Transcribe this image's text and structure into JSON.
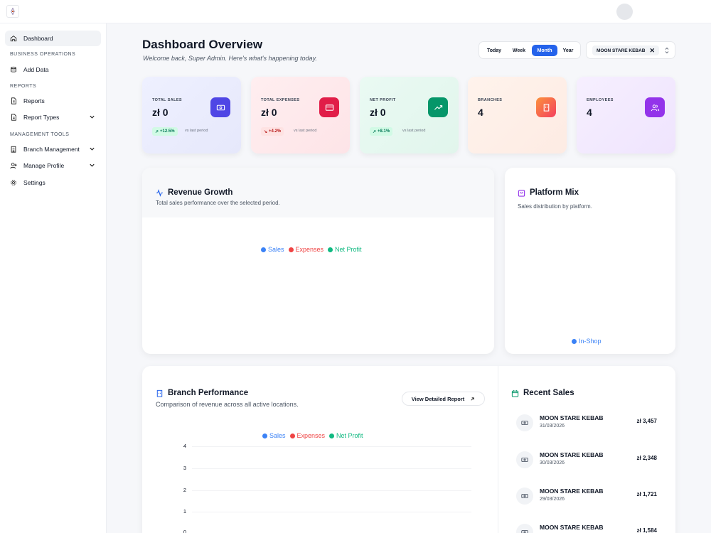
{
  "sidebar": {
    "dashboard": "Dashboard",
    "section_business": "BUSINESS OPERATIONS",
    "add_data": "Add Data",
    "section_reports": "REPORTS",
    "reports": "Reports",
    "report_types": "Report Types",
    "section_management": "MANAGEMENT TOOLS",
    "branch_management": "Branch Management",
    "manage_profile": "Manage Profile",
    "settings": "Settings"
  },
  "header": {
    "title": "Dashboard Overview",
    "subtitle": "Welcome back, Super Admin. Here's what's happening today."
  },
  "period": {
    "options": [
      "Today",
      "Week",
      "Month",
      "Year"
    ],
    "selected": "Month"
  },
  "branch_filter": {
    "value": "MOON STARE KEBAB",
    "clear": "✕"
  },
  "stats": [
    {
      "label": "TOTAL SALES",
      "value": "zł 0",
      "trend": "+12.5%",
      "trend_dir": "up",
      "vs": "vs last period",
      "color": "#4f46e5",
      "icon": "money-icon"
    },
    {
      "label": "TOTAL EXPENSES",
      "value": "zł 0",
      "trend": "+4.2%",
      "trend_dir": "down",
      "vs": "vs last period",
      "color": "#e11d48",
      "icon": "credit-card-icon"
    },
    {
      "label": "NET PROFIT",
      "value": "zł 0",
      "trend": "+8.1%",
      "trend_dir": "up",
      "vs": "vs last period",
      "color": "#059669",
      "icon": "trending-up-icon"
    },
    {
      "label": "BRANCHES",
      "value": "4",
      "color": "#f97316",
      "icon": "building-icon"
    },
    {
      "label": "EMPLOYEES",
      "value": "4",
      "color": "#9333ea",
      "icon": "users-icon"
    }
  ],
  "revenue": {
    "title": "Revenue Growth",
    "subtitle": "Total sales performance over the selected period.",
    "legend": [
      "Sales",
      "Expenses",
      "Net Profit"
    ]
  },
  "platform": {
    "title": "Platform Mix",
    "subtitle": "Sales distribution by platform.",
    "legend": [
      "In-Shop"
    ]
  },
  "branch_perf": {
    "title": "Branch Performance",
    "subtitle": "Comparison of revenue across all active locations.",
    "view_button": "View Detailed Report",
    "legend": [
      "Sales",
      "Expenses",
      "Net Profit"
    ],
    "yticks": [
      "4",
      "3",
      "2",
      "1",
      "0"
    ]
  },
  "recent_sales": {
    "title": "Recent Sales",
    "items": [
      {
        "name": "MOON STARE KEBAB",
        "date": "31/03/2026",
        "amount": "zł 3,457"
      },
      {
        "name": "MOON STARE KEBAB",
        "date": "30/03/2026",
        "amount": "zł 2,348"
      },
      {
        "name": "MOON STARE KEBAB",
        "date": "29/03/2026",
        "amount": "zł 1,721"
      },
      {
        "name": "MOON STARE KEBAB",
        "date": "",
        "amount": "zł 1,584"
      }
    ]
  },
  "colors": {
    "sales": "#3b82f6",
    "expenses": "#ef4444",
    "net_profit": "#10b981",
    "accent": "#2563eb"
  }
}
